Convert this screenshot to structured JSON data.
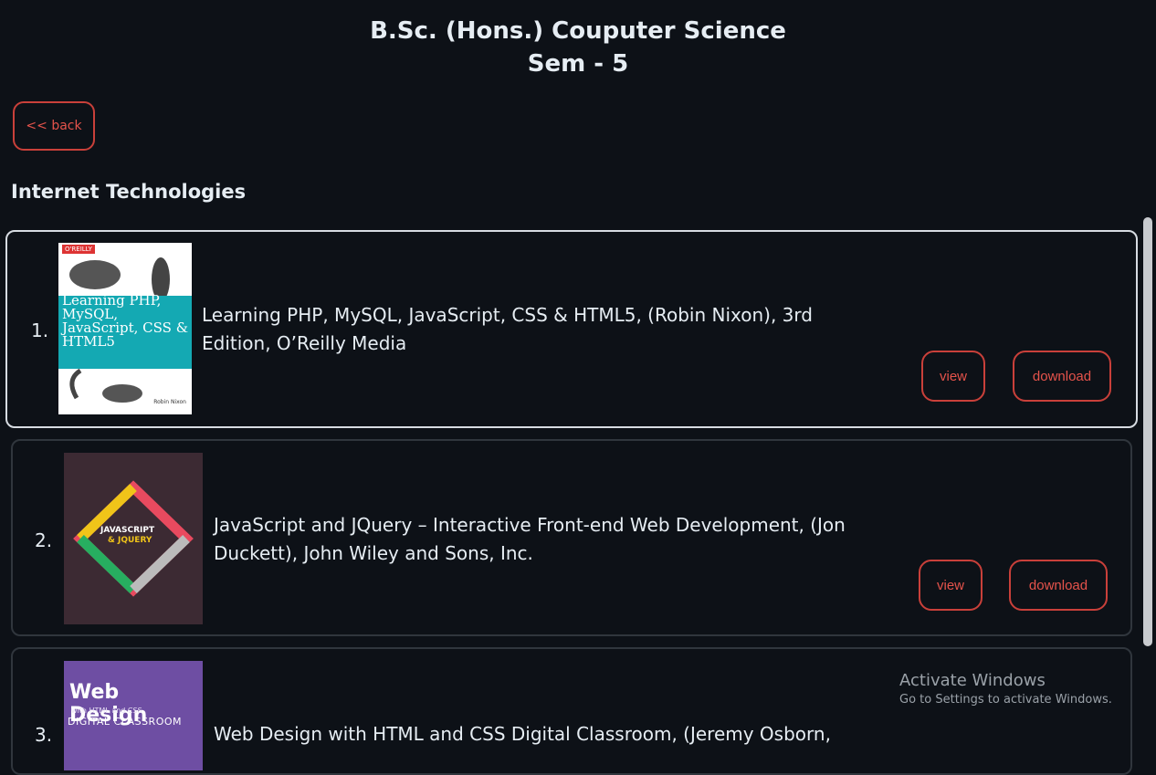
{
  "header": {
    "title_line1": "B.Sc. (Hons.) Couputer Science",
    "title_line2": "Sem - 5"
  },
  "back_label": "<< back",
  "section_title": "Internet Technologies",
  "books": [
    {
      "number": "1.",
      "title_line1": "Learning PHP, MySQL, JavaScript, CSS & HTML5, (Robin Nixon), 3rd",
      "title_line2": "Edition, O’Reilly Media",
      "view_label": "view",
      "download_label": "download",
      "cover": {
        "brand": "O'REILLY",
        "text": "Learning PHP, MySQL, JavaScript, CSS & HTML5",
        "author": "Robin Nixon"
      }
    },
    {
      "number": "2.",
      "title_line1": "JavaScript and JQuery – Interactive Front-end Web Development, (Jon",
      "title_line2": "Duckett), John Wiley and Sons, Inc.",
      "view_label": "view",
      "download_label": "download",
      "cover": {
        "text1": "JAVASCRIPT",
        "text2": "& JQUERY"
      }
    },
    {
      "number": "3.",
      "title_line1": "Web Design with HTML and CSS Digital Classroom, (Jeremy Osborn,",
      "cover": {
        "text1": "Web Design",
        "text2": "with HTML and CSS",
        "text3": "DIGITAL CLASSROOM"
      }
    }
  ],
  "watermark": {
    "line1": "Activate Windows",
    "line2": "Go to Settings to activate Windows."
  },
  "colors": {
    "background": "#0d1117",
    "accent": "#e5534b",
    "text": "#e6edf3"
  }
}
